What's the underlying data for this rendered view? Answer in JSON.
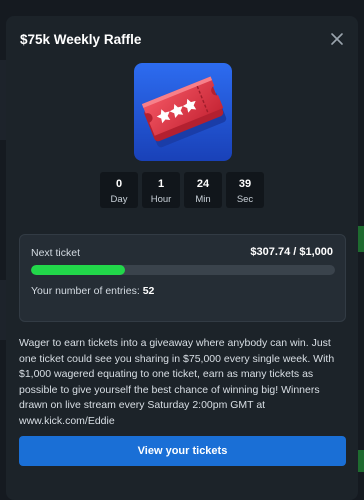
{
  "modal": {
    "title": "$75k Weekly Raffle",
    "close_icon": "close-icon",
    "art_icon": "raffle-tickets-icon"
  },
  "countdown": [
    {
      "value": "0",
      "unit": "Day"
    },
    {
      "value": "1",
      "unit": "Hour"
    },
    {
      "value": "24",
      "unit": "Min"
    },
    {
      "value": "39",
      "unit": "Sec"
    }
  ],
  "ticket_progress": {
    "label": "Next ticket",
    "amount_text": "$307.74  /  $1,000",
    "current": 307.74,
    "target": 1000,
    "entries_label": "Your number of entries:",
    "entries_count": "52"
  },
  "description": "Wager to earn tickets into a giveaway where anybody can win. Just one ticket could see you sharing in $75,000 every single week. With $1,000 wagered equating to one ticket, earn as many tickets as possible to give yourself the best chance of winning big! Winners drawn on live stream every Saturday 2:00pm GMT at www.kick.com/Eddie",
  "button": {
    "label": "View your tickets"
  },
  "colors": {
    "modal_bg": "#1c2329",
    "panel_bg": "#252d35",
    "progress_fill": "#22d74a",
    "button_bg": "#1a6fd6",
    "ticket_red": "#e63946",
    "ticket_blue": "#1e4fd0"
  }
}
